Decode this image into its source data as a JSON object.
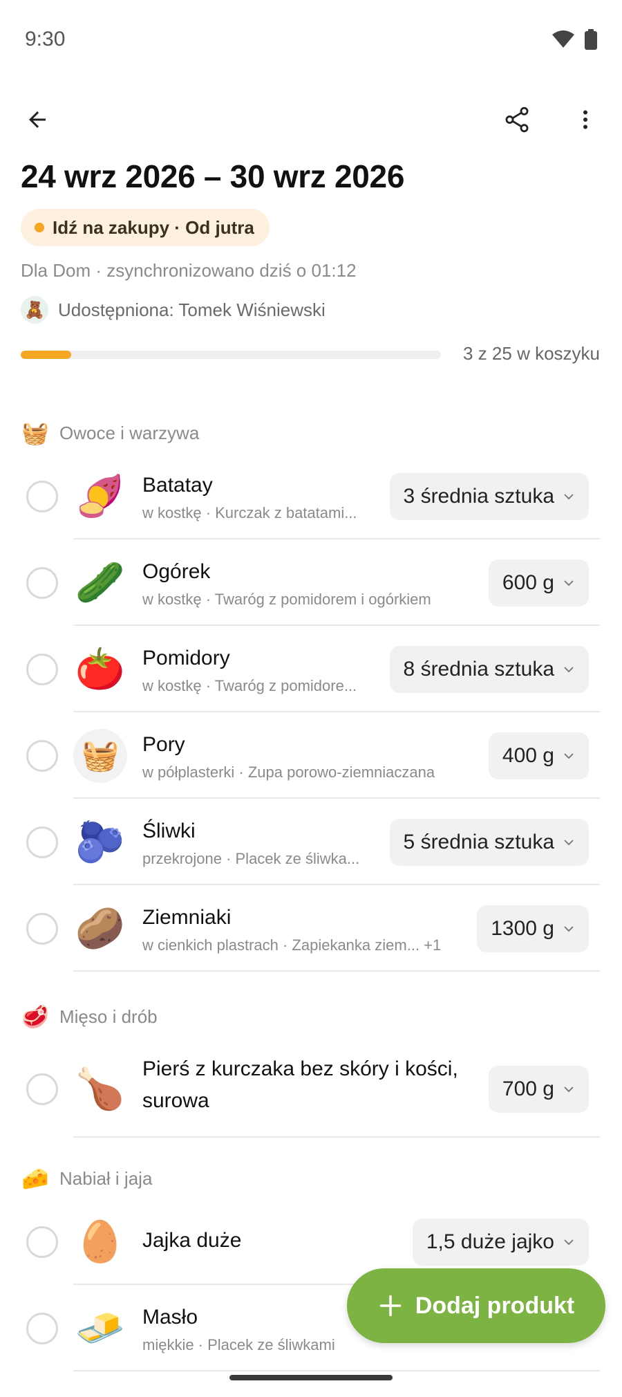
{
  "status_bar": {
    "time": "9:30",
    "icons": [
      "wifi-icon",
      "battery-icon"
    ]
  },
  "app_bar": {
    "back_icon": "arrow-left-icon",
    "share_icon": "share-icon",
    "more_icon": "more-vertical-icon"
  },
  "header": {
    "title": "24 wrz 2026 – 30 wrz 2026",
    "status_chip": "Idź na zakupy · Od jutra",
    "sync_info": "Dla Dom · zsynchronizowano dziś o 01:12",
    "shared_with": "Udostępniona: Tomek Wiśniewski",
    "avatar": "🧸"
  },
  "progress": {
    "label": "3 z 25 w koszyku",
    "fraction": 0.12
  },
  "sections": [
    {
      "title": "Owoce i warzywa",
      "emoji": "🧺",
      "items": [
        {
          "name": "Batatay",
          "subtitle": "w kostkę · Kurczak z batatami...",
          "quantity": "3 średnia sztuka",
          "emoji": "🍠"
        },
        {
          "name": "Ogórek",
          "subtitle": "w kostkę · Twaróg z pomidorem i ogórkiem",
          "quantity": "600 g",
          "emoji": "🥒"
        },
        {
          "name": "Pomidory",
          "subtitle": "w kostkę · Twaróg z pomidore...",
          "quantity": "8 średnia sztuka",
          "emoji": "🍅"
        },
        {
          "name": "Pory",
          "subtitle": "w półplasterki · Zupa porowo-ziemniaczana",
          "quantity": "400 g",
          "emoji": "🧺"
        },
        {
          "name": "Śliwki",
          "subtitle": "przekrojone · Placek ze śliwka...",
          "quantity": "5 średnia sztuka",
          "emoji": "🫐"
        },
        {
          "name": "Ziemniaki",
          "subtitle": "w cienkich plastrach · Zapiekanka ziem...  +1",
          "quantity": "1300 g",
          "emoji": "🥔"
        }
      ]
    },
    {
      "title": "Mięso i drób",
      "emoji": "🥩",
      "items": [
        {
          "name_line1": "Pierś z kurczaka bez skóry i kości,",
          "name_line2": "surowa",
          "quantity": "700 g",
          "emoji": "🍗"
        }
      ]
    },
    {
      "title": "Nabiał i jaja",
      "emoji": "🧀",
      "items": [
        {
          "name": "Jajka duże",
          "quantity": "1,5 duże jajko",
          "emoji": "🥚"
        },
        {
          "name": "Masło",
          "subtitle": "miękkie · Placek ze śliwkami",
          "emoji": "🧈"
        }
      ]
    }
  ],
  "fab": {
    "label": "Dodaj produkt",
    "icon": "plus-icon",
    "color": "#7cb342"
  },
  "colors": {
    "accent": "#f5a623",
    "fab": "#7cb342"
  }
}
